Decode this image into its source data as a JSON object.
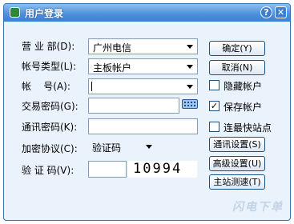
{
  "window": {
    "title": "用户登录",
    "help_glyph": "?",
    "close_glyph": "✕"
  },
  "form": {
    "dept": {
      "label": "营 业 部(D):",
      "value": "广州电信"
    },
    "account_type": {
      "label": "帐号类型(L):",
      "value": "主板帐户"
    },
    "account": {
      "label": "帐    号(A):",
      "value": ""
    },
    "trade_password": {
      "label": "交易密码(G):",
      "value": ""
    },
    "comm_password": {
      "label": "通讯密码(K):",
      "value": ""
    },
    "encryption": {
      "label": "加密协议(C):",
      "value": "验证码"
    },
    "captcha": {
      "label": "验 证 码(V):",
      "value": "",
      "image_text": "10994"
    }
  },
  "buttons": {
    "ok": "确定(Y)",
    "cancel": "取消(N)",
    "comm_settings": "通讯设置(S)",
    "advanced": "高级设置(U)",
    "speed_test": "主站测速(T)"
  },
  "checkboxes": {
    "hide_account": {
      "label": "隐藏帐户",
      "checked": false
    },
    "save_account": {
      "label": "保存帐户",
      "checked": true
    },
    "fast_connect": {
      "label": "连最快站点",
      "checked": false
    }
  },
  "icons": {
    "keyboard": "keyboard-icon",
    "help": "help-icon",
    "close": "close-icon"
  },
  "watermark": "闪电下单",
  "colors": {
    "titlebar": "#4f93dc",
    "background": "#eaf2fb",
    "border": "#3a6fb0"
  }
}
